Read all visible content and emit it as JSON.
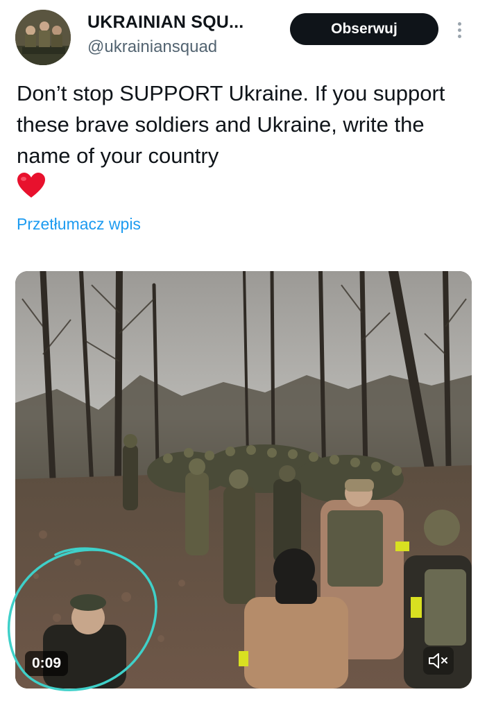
{
  "header": {
    "display_name": "UKRAINIAN SQU...",
    "handle": "@ukrainiansquad",
    "follow_label": "Obserwuj",
    "avatar_icon": "soldiers-avatar",
    "more_icon": "more-vertical-icon"
  },
  "tweet": {
    "text": "Don’t stop SUPPORT Ukraine. If you support these brave soldiers and Ukraine, write the name of your country",
    "emoji_icon": "red-heart-icon",
    "translate_label": "Przetłumacz wpis"
  },
  "media": {
    "duration": "0:09",
    "mute_icon": "speaker-muted-icon",
    "annotation": "teal-hand-drawn-circle"
  },
  "colors": {
    "link": "#1d9bf0",
    "button_bg": "#0f1419",
    "annotation": "#3fd0c9",
    "secondary_text": "#536471"
  }
}
